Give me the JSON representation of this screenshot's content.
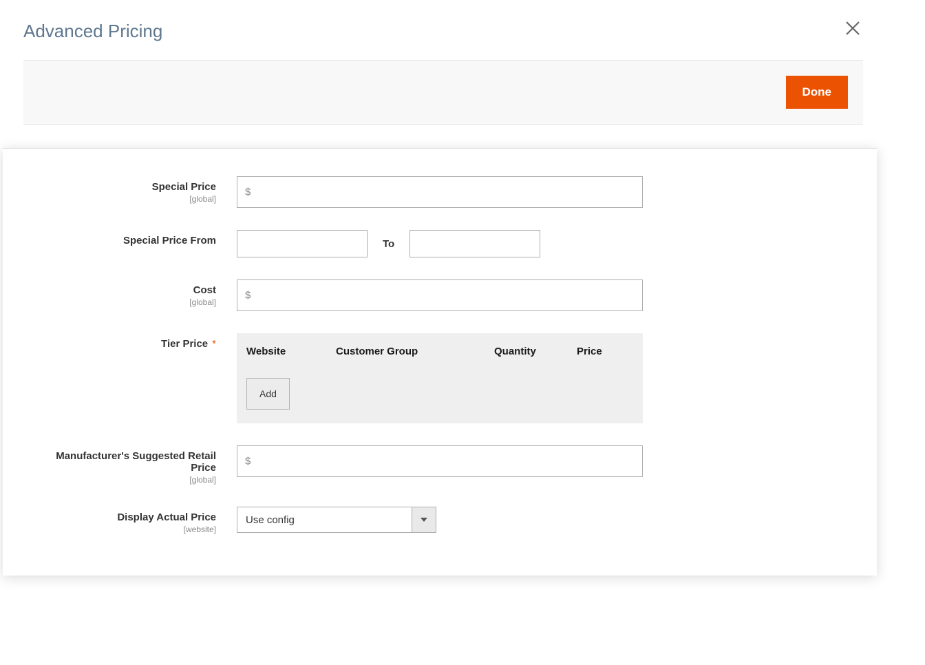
{
  "modal": {
    "title": "Advanced Pricing"
  },
  "toolbar": {
    "done_label": "Done"
  },
  "fields": {
    "special_price": {
      "label": "Special Price",
      "scope": "[global]",
      "currency": "$",
      "value": ""
    },
    "special_price_from": {
      "label": "Special Price From",
      "from_value": "",
      "to_label": "To",
      "to_value": ""
    },
    "cost": {
      "label": "Cost",
      "scope": "[global]",
      "currency": "$",
      "value": ""
    },
    "tier_price": {
      "label": "Tier Price",
      "required": "*",
      "columns": {
        "website": "Website",
        "customer_group": "Customer Group",
        "quantity": "Quantity",
        "price": "Price"
      },
      "add_label": "Add"
    },
    "msrp": {
      "label": "Manufacturer's Suggested Retail Price",
      "scope": "[global]",
      "currency": "$",
      "value": ""
    },
    "display_actual_price": {
      "label": "Display Actual Price",
      "scope": "[website]",
      "selected": "Use config"
    }
  }
}
